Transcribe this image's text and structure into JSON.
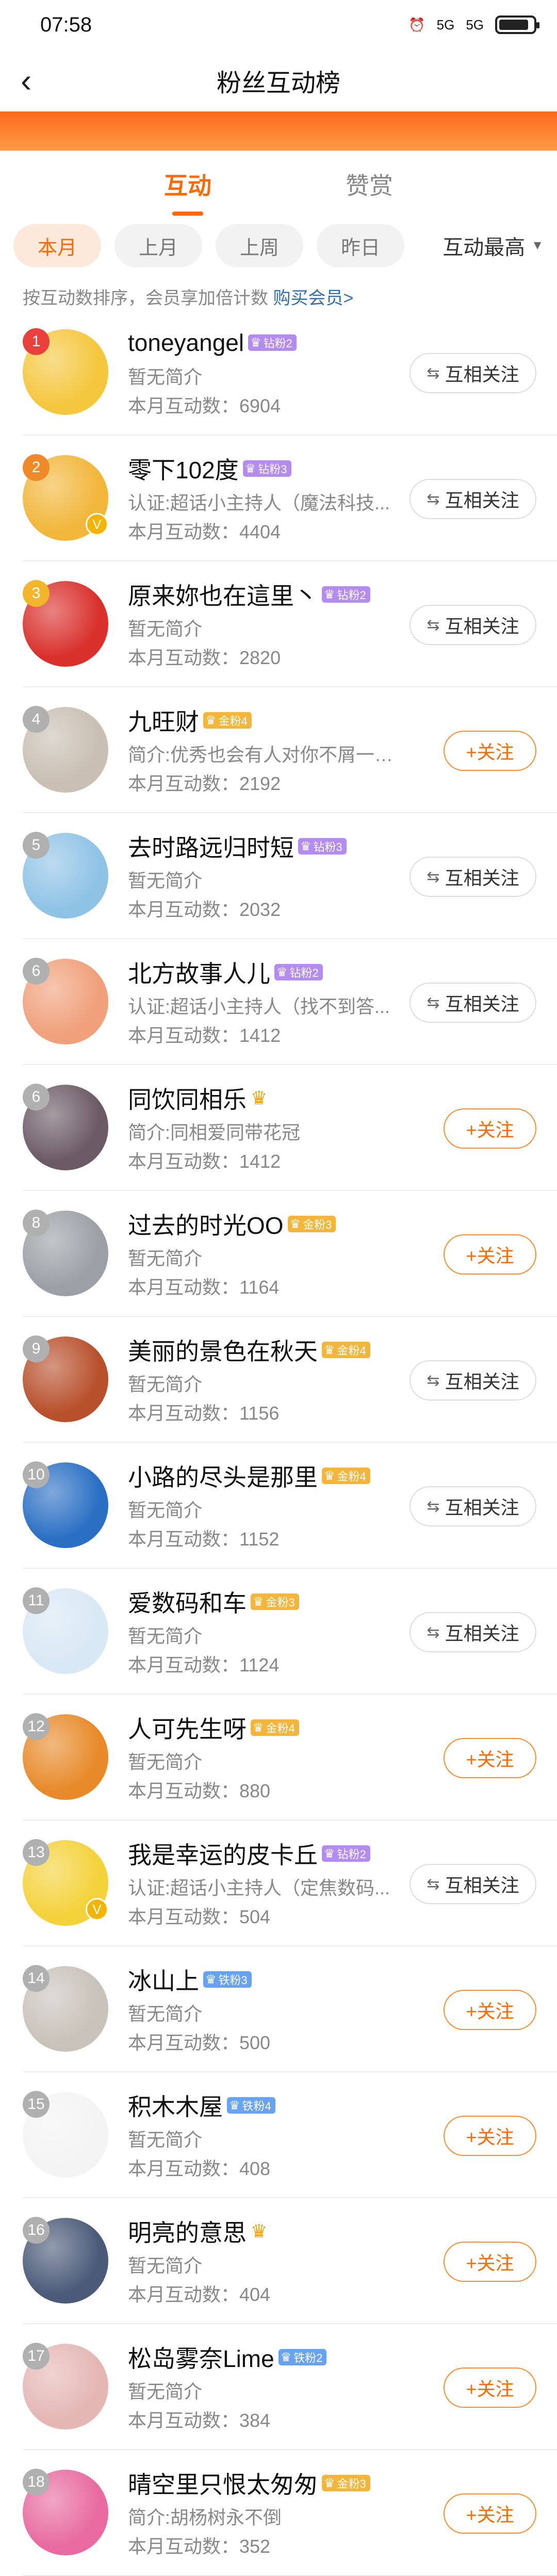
{
  "status_bar": {
    "time": "07:58",
    "signal_1": "5G",
    "signal_2": "5G"
  },
  "header": {
    "back_icon": "back-chevron-icon",
    "title": "粉丝互动榜"
  },
  "tabs": [
    {
      "label": "互动",
      "active": true
    },
    {
      "label": "赞赏",
      "active": false
    }
  ],
  "filters": [
    {
      "label": "本月",
      "active": true
    },
    {
      "label": "上月",
      "active": false
    },
    {
      "label": "上周",
      "active": false
    },
    {
      "label": "昨日",
      "active": false
    }
  ],
  "sort": {
    "label": "互动最高"
  },
  "hint": {
    "text": "按互动数排序，会员享加倍计数 ",
    "link": "购买会员>"
  },
  "fans": [
    {
      "rank": "1",
      "name": "toneyangel",
      "badge": "钻粉2",
      "badge_type": "purple",
      "desc": "暂无简介",
      "count": "本月互动数：6904",
      "action": "互相关注",
      "avatar_color": "#f5c73e",
      "rank_color": "#e8413c"
    },
    {
      "rank": "2",
      "name": "零下102度",
      "badge": "钻粉3",
      "badge_type": "purple",
      "desc": "认证:超话小主持人（魔法科技...",
      "count": "本月互动数：4404",
      "action": "互相关注",
      "avatar_color": "#f2b63a",
      "rank_color": "#f08a28",
      "verified": true
    },
    {
      "rank": "3",
      "name": "原来妳也在這里丶",
      "badge": "钻粉2",
      "badge_type": "purple",
      "desc": "暂无简介",
      "count": "本月互动数：2820",
      "action": "互相关注",
      "avatar_color": "#d9302c",
      "rank_color": "#f3b52c"
    },
    {
      "rank": "4",
      "name": "九旺财",
      "badge": "金粉4",
      "badge_type": "gold",
      "desc": "简介:优秀也会有人对你不屑一顾...",
      "count": "本月互动数：2192",
      "action": "+关注",
      "avatar_color": "#c9bfb3",
      "rank_color": "#b0b0b0"
    },
    {
      "rank": "5",
      "name": "去时路远归时短",
      "badge": "钻粉3",
      "badge_type": "purple",
      "desc": "暂无简介",
      "count": "本月互动数：2032",
      "action": "互相关注",
      "avatar_color": "#8fc3e6",
      "rank_color": "#b0b0b0"
    },
    {
      "rank": "6",
      "name": "北方故事人儿",
      "badge": "钻粉2",
      "badge_type": "purple",
      "desc": "认证:超话小主持人（找不到答...",
      "count": "本月互动数：1412",
      "action": "互相关注",
      "avatar_color": "#f0a07a",
      "rank_color": "#b0b0b0"
    },
    {
      "rank": "6",
      "name": "同饮同相乐",
      "badge": "",
      "badge_type": "crown",
      "desc": "简介:同相爱同带花冠",
      "count": "本月互动数：1412",
      "action": "+关注",
      "avatar_color": "#6b5a64",
      "rank_color": "#b0b0b0"
    },
    {
      "rank": "8",
      "name": "过去的时光OO",
      "badge": "金粉3",
      "badge_type": "gold",
      "desc": "暂无简介",
      "count": "本月互动数：1164",
      "action": "+关注",
      "avatar_color": "#9aa0a6",
      "rank_color": "#b0b0b0"
    },
    {
      "rank": "9",
      "name": "美丽的景色在秋天",
      "badge": "金粉4",
      "badge_type": "gold",
      "desc": "暂无简介",
      "count": "本月互动数：1156",
      "action": "互相关注",
      "avatar_color": "#b8502c",
      "rank_color": "#b0b0b0"
    },
    {
      "rank": "10",
      "name": "小路的尽头是那里",
      "badge": "金粉4",
      "badge_type": "gold",
      "desc": "暂无简介",
      "count": "本月互动数：1152",
      "action": "互相关注",
      "avatar_color": "#2a6fc4",
      "rank_color": "#b0b0b0"
    },
    {
      "rank": "11",
      "name": "爱数码和车",
      "badge": "金粉3",
      "badge_type": "gold",
      "desc": "暂无简介",
      "count": "本月互动数：1124",
      "action": "互相关注",
      "avatar_color": "#d8e8f4",
      "rank_color": "#b0b0b0"
    },
    {
      "rank": "12",
      "name": "人可先生呀",
      "badge": "金粉4",
      "badge_type": "gold",
      "desc": "暂无简介",
      "count": "本月互动数：880",
      "action": "+关注",
      "avatar_color": "#e88a2a",
      "rank_color": "#b0b0b0"
    },
    {
      "rank": "13",
      "name": "我是幸运的皮卡丘",
      "badge": "钻粉2",
      "badge_type": "purple",
      "desc": "认证:超话小主持人（定焦数码...",
      "count": "本月互动数：504",
      "action": "互相关注",
      "avatar_color": "#f4d23a",
      "rank_color": "#b0b0b0",
      "verified": true
    },
    {
      "rank": "14",
      "name": "冰山上",
      "badge": "铁粉3",
      "badge_type": "blue",
      "desc": "暂无简介",
      "count": "本月互动数：500",
      "action": "+关注",
      "avatar_color": "#c9c2ba",
      "rank_color": "#b0b0b0"
    },
    {
      "rank": "15",
      "name": "积木木屋",
      "badge": "铁粉4",
      "badge_type": "blue",
      "desc": "暂无简介",
      "count": "本月互动数：408",
      "action": "+关注",
      "avatar_color": "#f4f4f4",
      "rank_color": "#b0b0b0"
    },
    {
      "rank": "16",
      "name": "明亮的意思",
      "badge": "",
      "badge_type": "crown",
      "desc": "暂无简介",
      "count": "本月互动数：404",
      "action": "+关注",
      "avatar_color": "#4a5a78",
      "rank_color": "#b0b0b0"
    },
    {
      "rank": "17",
      "name": "松岛雾奈Lime",
      "badge": "铁粉2",
      "badge_type": "blue",
      "desc": "暂无简介",
      "count": "本月互动数：384",
      "action": "+关注",
      "avatar_color": "#e4b7b4",
      "rank_color": "#b0b0b0"
    },
    {
      "rank": "18",
      "name": "晴空里只恨太匆匆",
      "badge": "金粉3",
      "badge_type": "gold",
      "desc": "简介:胡杨树永不倒",
      "count": "本月互动数：352",
      "action": "+关注",
      "avatar_color": "#e86aa0",
      "rank_color": "#b0b0b0"
    }
  ]
}
